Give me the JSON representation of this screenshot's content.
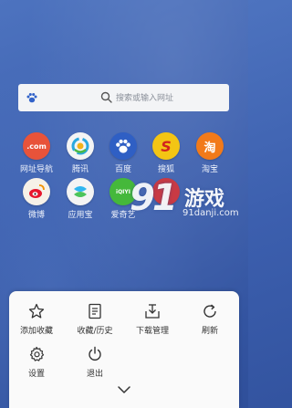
{
  "search": {
    "placeholder": "搜索或输入网址"
  },
  "shortcuts": [
    {
      "label": "网址导航",
      "glyph": ".com",
      "color": "#e8533a",
      "icon": "com-icon"
    },
    {
      "label": "腾讯",
      "glyph": "",
      "color": "#f4f4f4",
      "icon": "tencent-icon"
    },
    {
      "label": "百度",
      "glyph": "",
      "color": "#2f5fc4",
      "icon": "baidu-paw-icon"
    },
    {
      "label": "搜狐",
      "glyph": "S",
      "color": "#f3c514",
      "icon": "sohu-icon"
    },
    {
      "label": "淘宝",
      "glyph": "淘",
      "color": "#f27a1a",
      "icon": "taobao-icon"
    },
    {
      "label": "微博",
      "glyph": "",
      "color": "#f6f1e8",
      "icon": "weibo-icon"
    },
    {
      "label": "应用宝",
      "glyph": "",
      "color": "#f4f4f4",
      "icon": "yingyongbao-icon"
    },
    {
      "label": "爱奇艺",
      "glyph": "iQIYI",
      "color": "#45b83b",
      "icon": "iqiyi-icon"
    },
    {
      "label": "",
      "glyph": "",
      "color": "#c93a44",
      "icon": "partially-hidden-icon"
    }
  ],
  "watermark": {
    "number": "91",
    "name": "游戏",
    "url": "91danji.com"
  },
  "menu": {
    "items": [
      {
        "label": "添加收藏",
        "icon": "star-icon"
      },
      {
        "label": "收藏/历史",
        "icon": "document-icon"
      },
      {
        "label": "下载管理",
        "icon": "download-icon"
      },
      {
        "label": "刷新",
        "icon": "refresh-icon"
      },
      {
        "label": "设置",
        "icon": "gear-icon"
      },
      {
        "label": "退出",
        "icon": "power-icon"
      }
    ]
  },
  "colors": {
    "background": "#3c5fae",
    "panel": "#fafafa",
    "icon_stroke": "#333333"
  }
}
